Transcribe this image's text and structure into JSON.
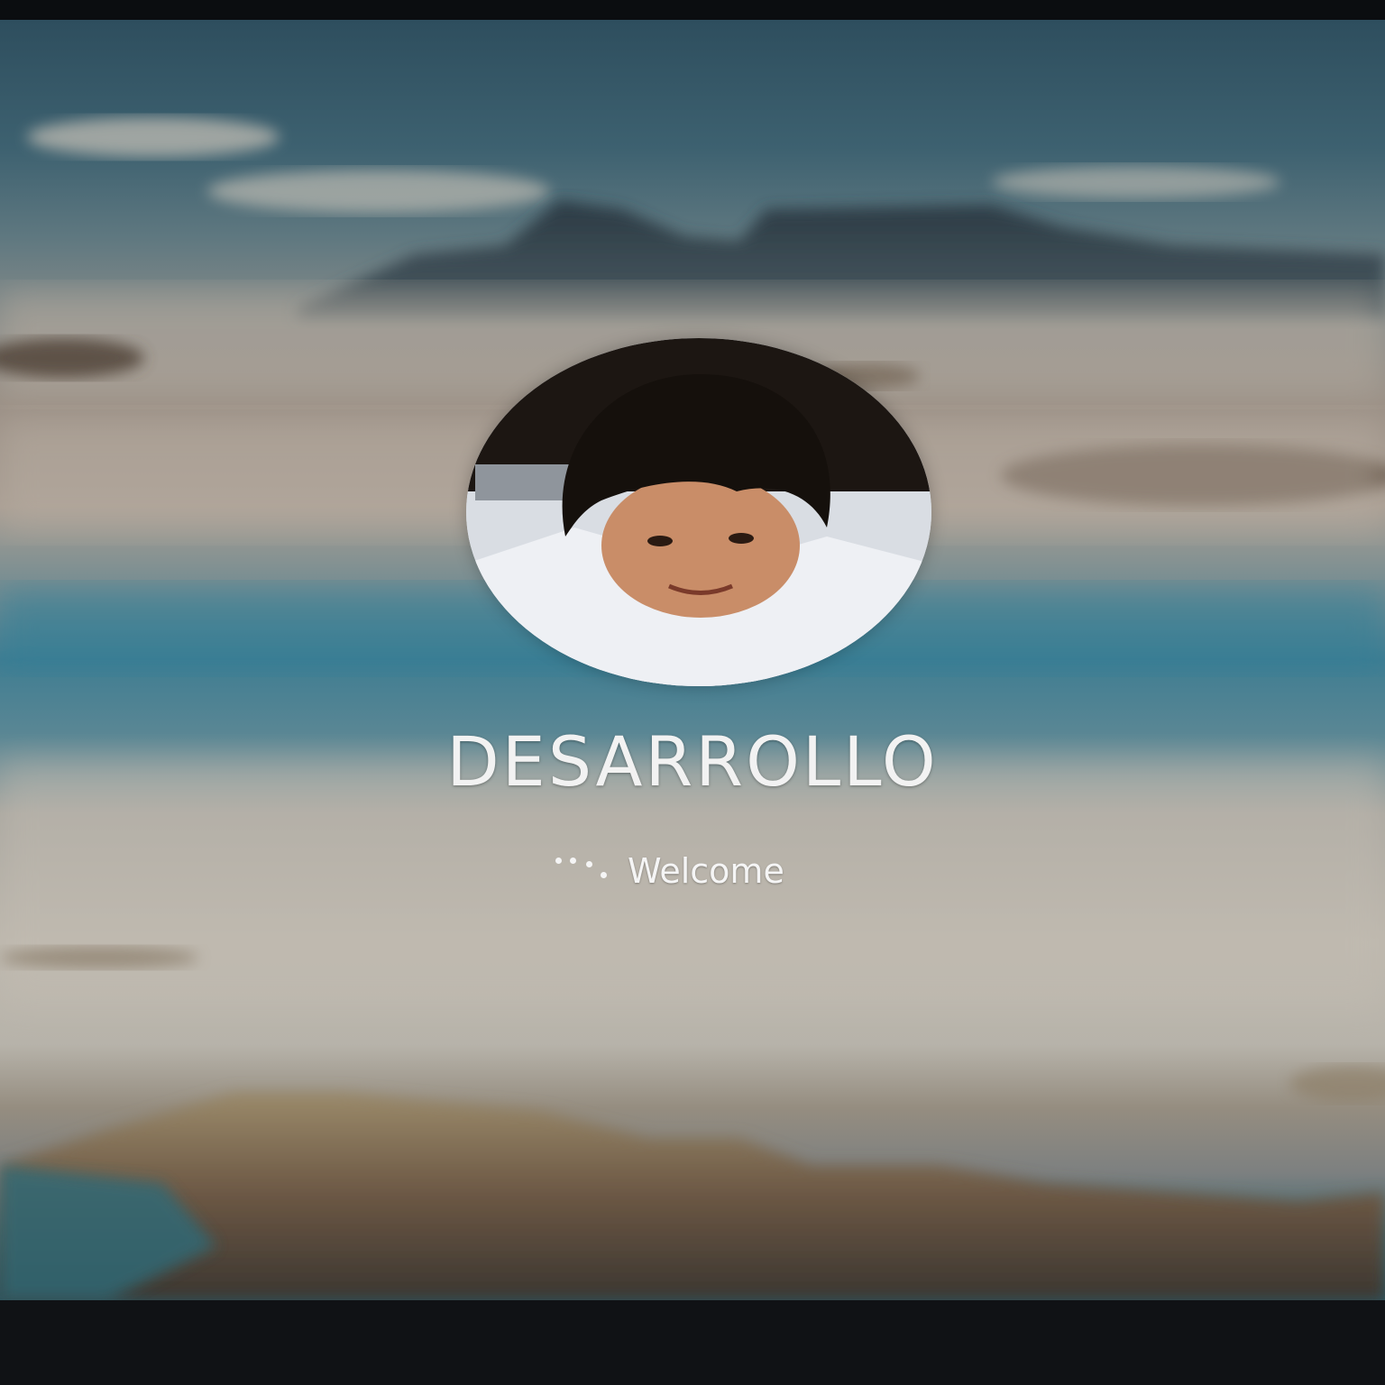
{
  "login_screen": {
    "username": "DESARROLLO",
    "status_text": "Welcome",
    "spinner_icon": "loading-dots-icon",
    "accent_text_color": "#f2f2f2"
  }
}
